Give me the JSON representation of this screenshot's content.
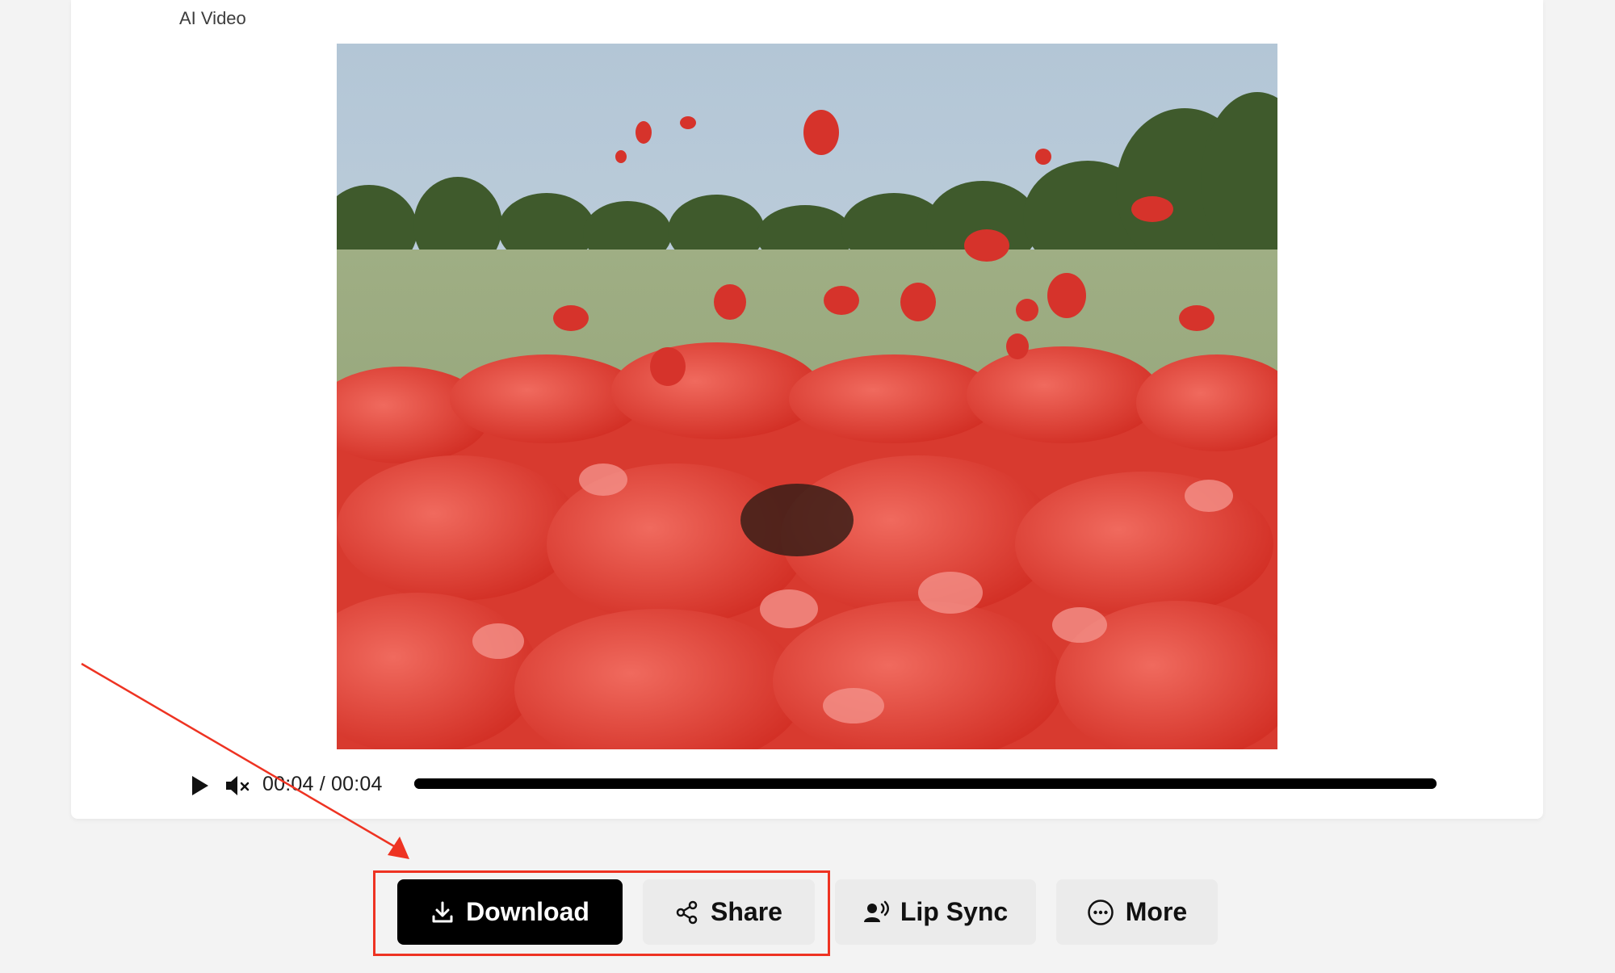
{
  "card": {
    "label": "AI Video"
  },
  "video": {
    "description_icon": "video-frame",
    "controls": {
      "play_icon": "play-icon",
      "mute_icon": "muted-speaker-icon",
      "time_display": "00:04 / 00:04",
      "current_time": "00:04",
      "duration": "00:04",
      "progress": 1.0
    }
  },
  "actions": {
    "download_label": "Download",
    "share_label": "Share",
    "lipsync_label": "Lip Sync",
    "more_label": "More"
  },
  "annotation": {
    "highlight_color": "#ee3322",
    "arrow_color": "#ee3322"
  },
  "colors": {
    "page_bg": "#f3f3f3",
    "primary_button": "#000000",
    "secondary_button": "#ebebeb"
  }
}
